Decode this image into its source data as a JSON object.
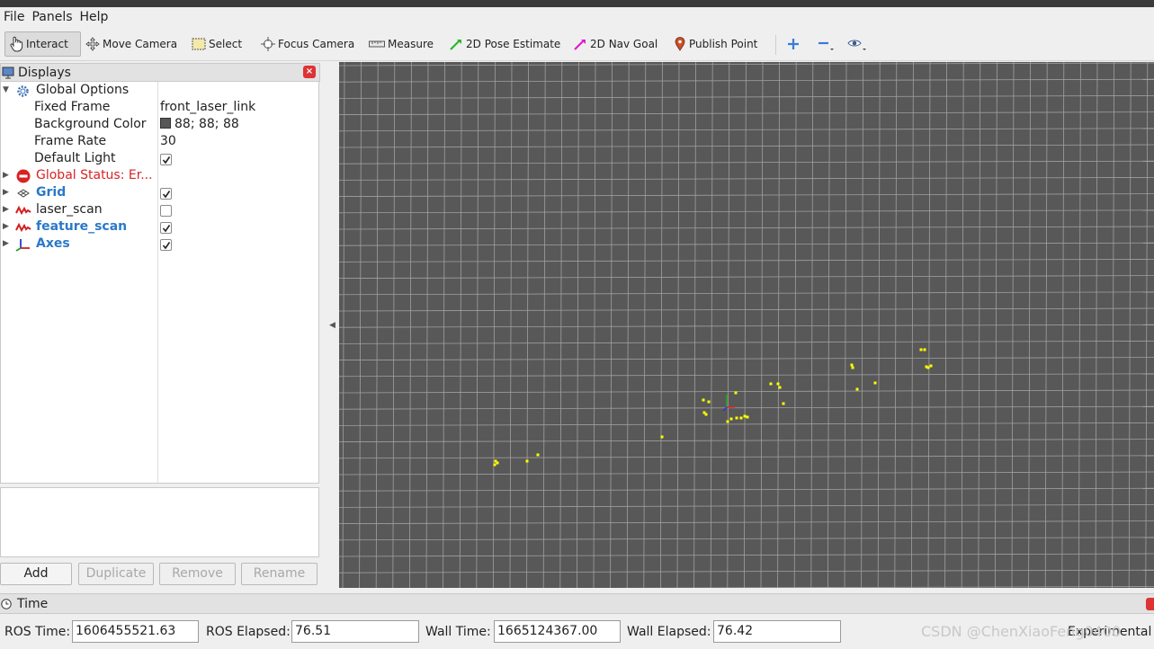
{
  "menubar": {
    "items": [
      "File",
      "Panels",
      "Help"
    ]
  },
  "toolbar": {
    "interact": "Interact",
    "move_camera": "Move Camera",
    "select": "Select",
    "focus_camera": "Focus Camera",
    "measure": "Measure",
    "pose_estimate": "2D Pose Estimate",
    "nav_goal": "2D Nav Goal",
    "publish_point": "Publish Point"
  },
  "displays": {
    "title": "Displays",
    "global_options": "Global Options",
    "fixed_frame_label": "Fixed Frame",
    "fixed_frame_value": "front_laser_link",
    "bg_color_label": "Background Color",
    "bg_color_value": "88; 88; 88",
    "frame_rate_label": "Frame Rate",
    "frame_rate_value": "30",
    "default_light_label": "Default Light",
    "global_status": "Global Status: Er...",
    "grid": "Grid",
    "laser_scan": "laser_scan",
    "feature_scan": "feature_scan",
    "axes": "Axes"
  },
  "checkboxes": {
    "default_light": true,
    "grid": true,
    "laser_scan": false,
    "feature_scan": true,
    "axes": true
  },
  "buttons": {
    "add": "Add",
    "duplicate": "Duplicate",
    "remove": "Remove",
    "rename": "Rename"
  },
  "time": {
    "title": "Time",
    "ros_time_label": "ROS Time:",
    "ros_time": "1606455521.63",
    "ros_elapsed_label": "ROS Elapsed:",
    "ros_elapsed": "76.51",
    "wall_time_label": "Wall Time:",
    "wall_time": "1665124367.00",
    "wall_elapsed_label": "Wall Elapsed:",
    "wall_elapsed": "76.42",
    "experimental": "Experimental"
  },
  "watermark": "CSDN @ChenXiaoFeng0400",
  "colors": {
    "viewport_bg": "#585858",
    "grid_line": "#a0a0a0",
    "scan_points": "#ffff00",
    "status_error": "#d82323",
    "display_blue": "#2a79c8"
  }
}
